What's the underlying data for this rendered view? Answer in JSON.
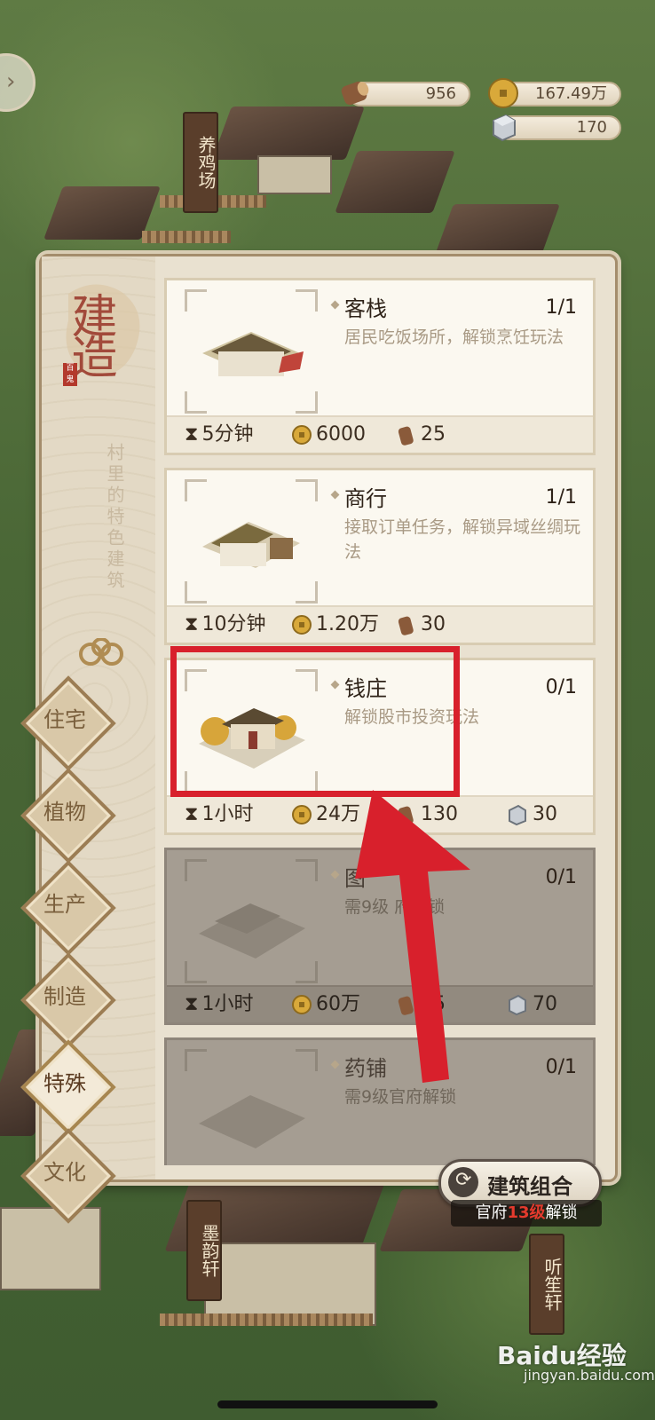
{
  "resources": {
    "wood": "956",
    "coins": "167.49万",
    "stone": "170"
  },
  "background": {
    "signs": [
      "养鸡场",
      "墨韵轩",
      "听笙轩"
    ]
  },
  "panel": {
    "title": "建造",
    "seal": "百鬼",
    "subtitle": "村里的特色建筑",
    "categories": [
      {
        "label": "住宅"
      },
      {
        "label": "植物"
      },
      {
        "label": "生产"
      },
      {
        "label": "制造"
      },
      {
        "label": "特殊"
      },
      {
        "label": "文化"
      }
    ],
    "active_category": "特殊",
    "buildings": [
      {
        "name": "客栈",
        "count": "1/1",
        "desc": "居民吃饭场所，解锁烹饪玩法",
        "time": "5分钟",
        "coin": "6000",
        "wood": "25",
        "stone": ""
      },
      {
        "name": "商行",
        "count": "1/1",
        "desc": "接取订单任务，解锁异域丝绸玩法",
        "time": "10分钟",
        "coin": "1.20万",
        "wood": "30",
        "stone": ""
      },
      {
        "name": "钱庄",
        "count": "0/1",
        "desc": "解锁股市投资玩法",
        "time": "1小时",
        "coin": "24万",
        "wood": "130",
        "stone": "30"
      },
      {
        "name": "图",
        "count": "0/1",
        "desc": "需9级 府解锁",
        "time": "1小时",
        "coin": "60万",
        "wood": "75",
        "stone": "70"
      },
      {
        "name": "药铺",
        "count": "0/1",
        "desc": "需9级官府解锁",
        "time": "",
        "coin": "",
        "wood": "",
        "stone": ""
      }
    ]
  },
  "combo_button": {
    "label": "建筑组合"
  },
  "unlock_note": {
    "prefix": "官府",
    "level": "13级",
    "suffix": "解锁"
  },
  "watermark": {
    "main": "Baidu经验",
    "sub": "jingyan.baidu.com"
  },
  "colors": {
    "highlight": "#d8202c",
    "accent_red": "#e43a2d"
  }
}
